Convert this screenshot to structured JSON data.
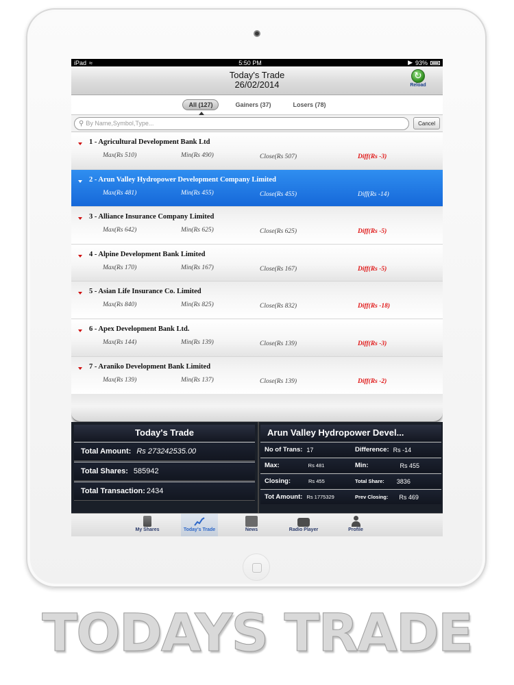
{
  "status_bar": {
    "device": "iPad",
    "time": "5:50 PM",
    "battery": "93%"
  },
  "nav": {
    "title": "Today's Trade",
    "date": "26/02/2014",
    "reload_label": "Reload"
  },
  "segments": [
    {
      "label": "All (127)",
      "active": true
    },
    {
      "label": "Gainers (37)",
      "active": false
    },
    {
      "label": "Losers (78)",
      "active": false
    }
  ],
  "search": {
    "placeholder": "By Name,Symbol,Type...",
    "cancel_label": "Cancel"
  },
  "companies": [
    {
      "name": "1 - Agricultural Development Bank Ltd",
      "max": "Max(Rs 510)",
      "min": "Min(Rs 490)",
      "close": "Close(Rs 507)",
      "diff": "Diff(Rs -3)"
    },
    {
      "name": "2 - Arun Valley Hydropower Development Company Limited",
      "max": "Max(Rs 481)",
      "min": "Min(Rs 455)",
      "close": "Close(Rs 455)",
      "diff": "Diff(Rs -14)",
      "selected": true
    },
    {
      "name": "3 - Alliance Insurance Company Limited",
      "max": "Max(Rs 642)",
      "min": "Min(Rs 625)",
      "close": "Close(Rs 625)",
      "diff": "Diff(Rs -5)"
    },
    {
      "name": "4 - Alpine Development Bank Limited",
      "max": "Max(Rs 170)",
      "min": "Min(Rs 167)",
      "close": "Close(Rs 167)",
      "diff": "Diff(Rs -5)"
    },
    {
      "name": "5 - Asian Life Insurance Co. Limited",
      "max": "Max(Rs 840)",
      "min": "Min(Rs 825)",
      "close": "Close(Rs 832)",
      "diff": "Diff(Rs -18)"
    },
    {
      "name": "6 - Apex Development Bank Ltd.",
      "max": "Max(Rs 144)",
      "min": "Min(Rs 139)",
      "close": "Close(Rs 139)",
      "diff": "Diff(Rs -3)"
    },
    {
      "name": "7 - Araniko Development Bank Limited",
      "max": "Max(Rs 139)",
      "min": "Min(Rs 137)",
      "close": "Close(Rs 139)",
      "diff": "Diff(Rs -2)"
    }
  ],
  "summary": {
    "title": "Today's Trade",
    "total_amount_label": "Total Amount:",
    "total_amount": "Rs 273242535.00",
    "total_shares_label": "Total Shares:",
    "total_shares": "585942",
    "total_transaction_label": "Total Transaction:",
    "total_transaction": "2434"
  },
  "detail": {
    "title": "Arun Valley Hydropower Devel...",
    "no_of_trans_label": "No of Trans:",
    "no_of_trans": "17",
    "difference_label": "Difference:",
    "difference": "Rs -14",
    "max_label": "Max:",
    "max": "Rs 481",
    "min_label": "Min:",
    "min": "Rs 455",
    "closing_label": "Closing:",
    "closing": "Rs 455",
    "total_share_label": "Total Share:",
    "total_share": "3836",
    "tot_amount_label": "Tot Amount:",
    "tot_amount": "Rs 1775329",
    "prev_closing_label": "Prev Closing:",
    "prev_closing": "Rs 469"
  },
  "tabs": [
    {
      "label": "My Shares",
      "icon": "shares-icon"
    },
    {
      "label": "Today's Trade",
      "icon": "trade-chart-icon",
      "active": true
    },
    {
      "label": "News",
      "icon": "news-icon"
    },
    {
      "label": "Radio Player",
      "icon": "radio-icon"
    },
    {
      "label": "Profile",
      "icon": "profile-icon"
    }
  ],
  "headline": "TODAYS TRADE"
}
